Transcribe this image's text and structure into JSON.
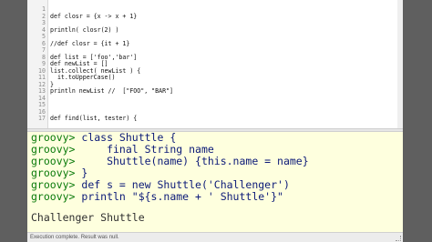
{
  "editor": {
    "lines": [
      {
        "n": "1",
        "text": ""
      },
      {
        "n": "2",
        "text": "def closr = {x -> x + 1}"
      },
      {
        "n": "3",
        "text": ""
      },
      {
        "n": "4",
        "text": "println( closr(2) )"
      },
      {
        "n": "5",
        "text": ""
      },
      {
        "n": "6",
        "text": "//def closr = {it + 1}"
      },
      {
        "n": "7",
        "text": ""
      },
      {
        "n": "8",
        "text": "def list = ['foo','bar']"
      },
      {
        "n": "9",
        "text": "def newList = []"
      },
      {
        "n": "10",
        "text": "list.collect( newList ) {"
      },
      {
        "n": "11",
        "text": "  it.toUpperCase()"
      },
      {
        "n": "12",
        "text": "}"
      },
      {
        "n": "13",
        "text": "println newList //  [\"FOO\", \"BAR\"]"
      },
      {
        "n": "14",
        "text": ""
      },
      {
        "n": "15",
        "text": ""
      },
      {
        "n": "16",
        "text": ""
      },
      {
        "n": "17",
        "text": "def find(list, tester) {"
      }
    ]
  },
  "output": {
    "prompt": "groovy>",
    "lines": [
      " class Shuttle {",
      "     final String name",
      "     Shuttle(name) {this.name = name}",
      " }",
      " def s = new Shuttle('Challenger')",
      " println \"${s.name + ' Shuttle'}\""
    ],
    "result": "Challenger Shuttle"
  },
  "status": {
    "text": "Execution complete. Result was null."
  }
}
